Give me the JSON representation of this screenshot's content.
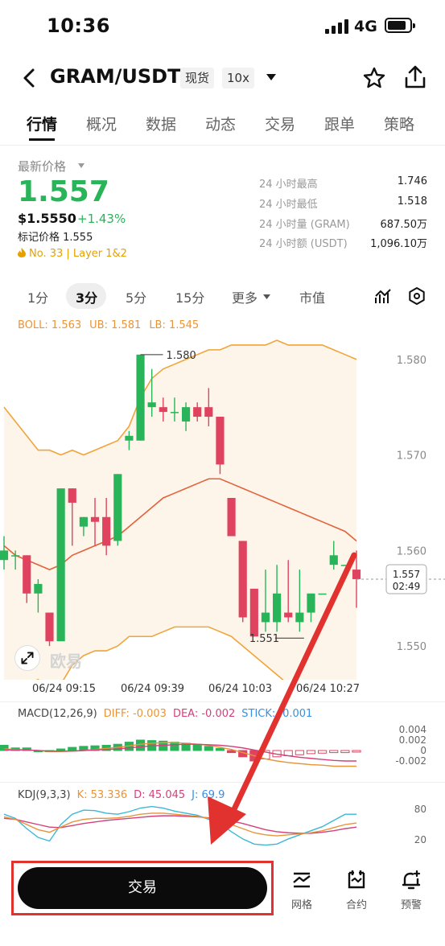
{
  "status": {
    "time": "10:36",
    "network": "4G"
  },
  "header": {
    "pair": "GRAM/USDT",
    "market_type": "现货",
    "leverage": "10x"
  },
  "tabs": [
    "行情",
    "概况",
    "数据",
    "动态",
    "交易",
    "跟单",
    "策略"
  ],
  "price": {
    "label": "最新价格",
    "last": "1.557",
    "usd": "$1.5550",
    "change": "+1.43%",
    "mark": "标记价格 1.555",
    "rank": "No. 33  |  Layer 1&2"
  },
  "stats": [
    {
      "label": "24 小时最高",
      "value": "1.746"
    },
    {
      "label": "24 小时最低",
      "value": "1.518"
    },
    {
      "label": "24 小时量 (GRAM)",
      "value": "687.50万"
    },
    {
      "label": "24 小时额 (USDT)",
      "value": "1,096.10万"
    }
  ],
  "intervals": [
    "1分",
    "3分",
    "5分",
    "15分",
    "更多",
    "市值"
  ],
  "boll": {
    "boll": "BOLL: 1.563",
    "ub": "UB: 1.581",
    "lb": "LB: 1.545"
  },
  "chart": {
    "y_ticks": [
      "1.580",
      "1.570",
      "1.560",
      "1.550"
    ],
    "high_label": "1.580",
    "low_label": "1.551",
    "current_price": "1.557",
    "countdown": "02:49",
    "time_labels": [
      "06/24 09:15",
      "06/24 09:39",
      "06/24 10:03",
      "06/24 10:27"
    ],
    "watermark": "欧易"
  },
  "macd": {
    "name": "MACD(12,26,9)",
    "diff": "DIFF: -0.003",
    "dea": "DEA: -0.002",
    "stick": "STICK: -0.001",
    "ticks": [
      "0.004",
      "0.002",
      "0",
      "-0.002"
    ]
  },
  "kdj": {
    "name": "KDJ(9,3,3)",
    "k": "K: 53.336",
    "d": "D: 45.045",
    "j": "J: 69.9",
    "ticks": [
      "80",
      "20"
    ]
  },
  "bottom": {
    "trade": "交易",
    "grid": "网格",
    "contract": "合约",
    "alert": "预警"
  },
  "colors": {
    "up": "#2ab45a",
    "down": "#e0435f",
    "boll_band": "#f0a43a",
    "boll_mid": "#e2623b",
    "annotation": "#e2322f"
  },
  "chart_data": {
    "type": "candlestick",
    "y_range": [
      1.549,
      1.582
    ],
    "x_labels": [
      "06/24 09:15",
      "06/24 09:39",
      "06/24 10:03",
      "06/24 10:27"
    ],
    "candles": [
      {
        "o": 1.559,
        "c": 1.56,
        "h": 1.5615,
        "l": 1.558
      },
      {
        "o": 1.5595,
        "c": 1.5595,
        "h": 1.56,
        "l": 1.558
      },
      {
        "o": 1.5595,
        "c": 1.5555,
        "h": 1.5595,
        "l": 1.5545
      },
      {
        "o": 1.5555,
        "c": 1.5565,
        "h": 1.557,
        "l": 1.5535
      },
      {
        "o": 1.5535,
        "c": 1.5505,
        "h": 1.5535,
        "l": 1.55
      },
      {
        "o": 1.5505,
        "c": 1.5665,
        "h": 1.5665,
        "l": 1.5505
      },
      {
        "o": 1.5665,
        "c": 1.565,
        "h": 1.5665,
        "l": 1.5605
      },
      {
        "o": 1.5625,
        "c": 1.5635,
        "h": 1.5635,
        "l": 1.5615
      },
      {
        "o": 1.5635,
        "c": 1.563,
        "h": 1.5655,
        "l": 1.5605
      },
      {
        "o": 1.5635,
        "c": 1.5605,
        "h": 1.5655,
        "l": 1.5595
      },
      {
        "o": 1.561,
        "c": 1.568,
        "h": 1.568,
        "l": 1.5605
      },
      {
        "o": 1.5715,
        "c": 1.572,
        "h": 1.5725,
        "l": 1.5705
      },
      {
        "o": 1.5715,
        "c": 1.5805,
        "h": 1.5805,
        "l": 1.5715
      },
      {
        "o": 1.575,
        "c": 1.5755,
        "h": 1.579,
        "l": 1.574
      },
      {
        "o": 1.575,
        "c": 1.5745,
        "h": 1.576,
        "l": 1.5735
      },
      {
        "o": 1.5745,
        "c": 1.5745,
        "h": 1.576,
        "l": 1.5735
      },
      {
        "o": 1.5735,
        "c": 1.575,
        "h": 1.5755,
        "l": 1.5725
      },
      {
        "o": 1.575,
        "c": 1.574,
        "h": 1.5755,
        "l": 1.5735
      },
      {
        "o": 1.575,
        "c": 1.574,
        "h": 1.577,
        "l": 1.573
      },
      {
        "o": 1.574,
        "c": 1.569,
        "h": 1.574,
        "l": 1.568
      },
      {
        "o": 1.5655,
        "c": 1.5615,
        "h": 1.5655,
        "l": 1.5615
      },
      {
        "o": 1.561,
        "c": 1.553,
        "h": 1.561,
        "l": 1.5525
      },
      {
        "o": 1.556,
        "c": 1.551,
        "h": 1.556,
        "l": 1.551
      },
      {
        "o": 1.5525,
        "c": 1.5535,
        "h": 1.558,
        "l": 1.5515
      },
      {
        "o": 1.5525,
        "c": 1.5555,
        "h": 1.5585,
        "l": 1.5515
      },
      {
        "o": 1.5535,
        "c": 1.553,
        "h": 1.559,
        "l": 1.5525
      },
      {
        "o": 1.5525,
        "c": 1.5535,
        "h": 1.558,
        "l": 1.5515
      },
      {
        "o": 1.5535,
        "c": 1.5555,
        "h": 1.5555,
        "l": 1.5525
      },
      {
        "o": 1.5555,
        "c": 1.5555,
        "h": 1.5555,
        "l": 1.5555
      },
      {
        "o": 1.5585,
        "c": 1.5595,
        "h": 1.561,
        "l": 1.558
      },
      {
        "o": 1.5585,
        "c": 1.5585,
        "h": 1.5585,
        "l": 1.5585
      },
      {
        "o": 1.558,
        "c": 1.557,
        "h": 1.56,
        "l": 1.554
      }
    ],
    "boll_upper": [
      1.575,
      1.5735,
      1.572,
      1.5705,
      1.5705,
      1.57,
      1.5705,
      1.57,
      1.5705,
      1.571,
      1.5715,
      1.573,
      1.576,
      1.578,
      1.579,
      1.5795,
      1.58,
      1.5805,
      1.581,
      1.581,
      1.5815,
      1.5815,
      1.5815,
      1.5815,
      1.582,
      1.5815,
      1.5815,
      1.5815,
      1.5815,
      1.581,
      1.5805,
      1.58
    ],
    "boll_mid": [
      1.5605,
      1.5595,
      1.559,
      1.5585,
      1.558,
      1.5585,
      1.5595,
      1.56,
      1.5605,
      1.561,
      1.5615,
      1.5625,
      1.5635,
      1.5645,
      1.5655,
      1.566,
      1.5665,
      1.567,
      1.5675,
      1.5675,
      1.567,
      1.5665,
      1.566,
      1.5655,
      1.565,
      1.5645,
      1.564,
      1.5635,
      1.563,
      1.5625,
      1.562,
      1.561
    ],
    "boll_lower": [
      1.5455,
      1.5455,
      1.546,
      1.5465,
      1.5455,
      1.546,
      1.548,
      1.549,
      1.5495,
      1.5495,
      1.55,
      1.551,
      1.551,
      1.551,
      1.5515,
      1.552,
      1.552,
      1.552,
      1.552,
      1.5515,
      1.551,
      1.55,
      1.549,
      1.548,
      1.547,
      1.546,
      1.545,
      1.544,
      1.543,
      1.542,
      1.5415,
      1.541
    ],
    "macd_stick": [
      0.001,
      0.0005,
      0.0005,
      0,
      0,
      0.0003,
      0.0006,
      0.0008,
      0.0009,
      0.001,
      0.0012,
      0.0016,
      0.002,
      0.0019,
      0.0018,
      0.0016,
      0.0014,
      0.0012,
      0.0008,
      0.0004,
      -0.0004,
      -0.0012,
      -0.002,
      -0.0016,
      -0.0012,
      -0.001,
      -0.0008,
      -0.0006,
      -0.0005,
      -0.0004,
      -0.0004,
      -0.0003
    ],
    "macd_diff": [
      0.0003,
      0.0002,
      0.0001,
      0,
      -0.0002,
      -0.0002,
      -0.0001,
      0,
      0.0002,
      0.0004,
      0.0006,
      0.0009,
      0.0012,
      0.0014,
      0.0015,
      0.0015,
      0.0014,
      0.0012,
      0.001,
      0.0006,
      0.0002,
      -0.0004,
      -0.001,
      -0.0016,
      -0.002,
      -0.0023,
      -0.0025,
      -0.0027,
      -0.0028,
      -0.003,
      -0.003,
      -0.003
    ],
    "macd_dea": [
      0.0001,
      0.0001,
      0.0001,
      0,
      -0.0001,
      -0.0001,
      -0.0001,
      0,
      0.0001,
      0.0002,
      0.0003,
      0.0005,
      0.0007,
      0.0009,
      0.001,
      0.0011,
      0.0012,
      0.0012,
      0.0011,
      0.001,
      0.0008,
      0.0005,
      0.0001,
      -0.0003,
      -0.0007,
      -0.001,
      -0.0013,
      -0.0015,
      -0.0017,
      -0.0019,
      -0.002,
      -0.002
    ],
    "kdj_k": [
      65,
      60,
      50,
      40,
      35,
      45,
      55,
      60,
      62,
      62,
      63,
      66,
      70,
      72,
      72,
      70,
      68,
      66,
      62,
      58,
      50,
      42,
      34,
      30,
      28,
      30,
      32,
      34,
      38,
      44,
      50,
      53
    ],
    "kdj_d": [
      62,
      60,
      55,
      50,
      45,
      44,
      48,
      52,
      55,
      58,
      60,
      62,
      64,
      66,
      67,
      67,
      66,
      65,
      63,
      61,
      57,
      52,
      46,
      40,
      36,
      34,
      33,
      33,
      35,
      38,
      42,
      45
    ],
    "kdj_j": [
      70,
      62,
      42,
      25,
      18,
      50,
      70,
      78,
      77,
      72,
      70,
      75,
      82,
      85,
      82,
      76,
      72,
      68,
      60,
      52,
      36,
      22,
      12,
      10,
      12,
      22,
      30,
      38,
      46,
      58,
      70,
      70
    ]
  }
}
